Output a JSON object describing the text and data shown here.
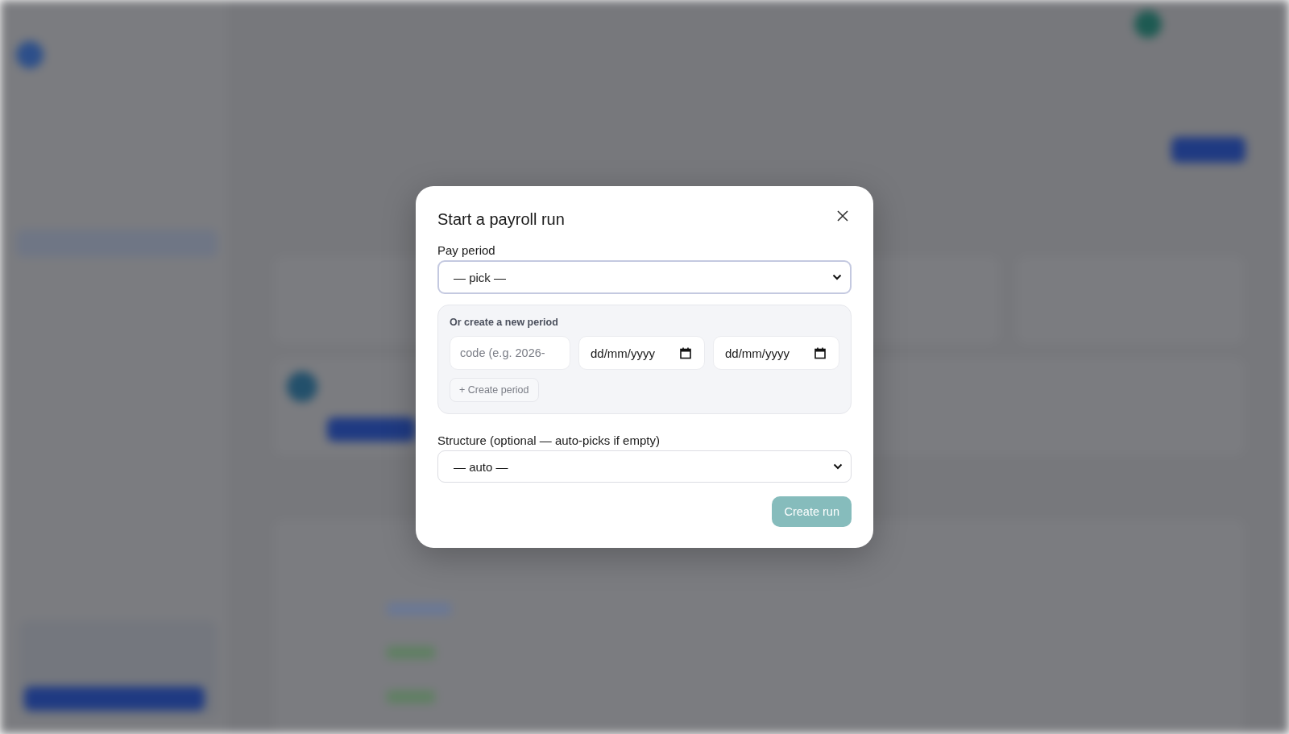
{
  "modal": {
    "title": "Start a payroll run",
    "pay_period": {
      "label": "Pay period",
      "value": "— pick —",
      "focused": true
    },
    "new_period": {
      "heading": "Or create a new period",
      "code": {
        "placeholder": "code (e.g. 2026-"
      },
      "start_date": {
        "text": "dd/mm/yyyy"
      },
      "end_date": {
        "text": "dd/mm/yyyy"
      },
      "create_button": {
        "label": "+ Create period"
      }
    },
    "structure": {
      "label": "Structure (optional — auto-picks if empty)",
      "value": "— auto —",
      "focused": false
    },
    "create_run": {
      "label": "Create run",
      "disabled": true
    }
  }
}
